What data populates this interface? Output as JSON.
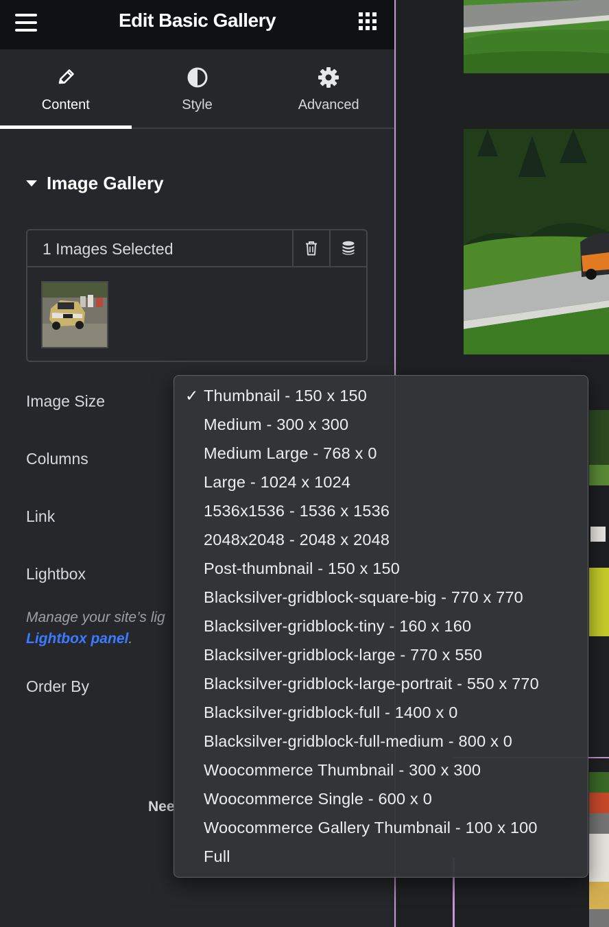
{
  "panel": {
    "title": "Edit Basic Gallery",
    "tabs": [
      {
        "label": "Content",
        "icon": "pencil-icon",
        "active": true
      },
      {
        "label": "Style",
        "icon": "half-circle-icon",
        "active": false
      },
      {
        "label": "Advanced",
        "icon": "gear-icon",
        "active": false
      }
    ],
    "section_title": "Image Gallery",
    "gallery": {
      "selected_text": "1 Images Selected",
      "thumbnail": "rally-car-thumbnail"
    },
    "fields": {
      "image_size": "Image Size",
      "columns": "Columns",
      "link": "Link",
      "lightbox": "Lightbox",
      "order_by": "Order By"
    },
    "lightbox_note": {
      "text": "Manage your site’s lig",
      "link": "Lightbox panel",
      "after": "."
    },
    "need_help": "Nee"
  },
  "dropdown": {
    "selected_index": 0,
    "check_mark": "✓",
    "options": [
      "Thumbnail - 150 x 150",
      "Medium - 300 x 300",
      "Medium Large - 768 x 0",
      "Large - 1024 x 1024",
      "1536x1536 - 1536 x 1536",
      "2048x2048 - 2048 x 2048",
      "Post-thumbnail - 150 x 150",
      "Blacksilver-gridblock-square-big - 770 x 770",
      "Blacksilver-gridblock-tiny - 160 x 160",
      "Blacksilver-gridblock-large - 770 x 550",
      "Blacksilver-gridblock-large-portrait - 550 x 770",
      "Blacksilver-gridblock-full - 1400 x 0",
      "Blacksilver-gridblock-full-medium - 800 x 0",
      "Woocommerce Thumbnail - 300 x 300",
      "Woocommerce Single - 600 x 0",
      "Woocommerce Gallery Thumbnail - 100 x 100",
      "Full"
    ]
  },
  "colors": {
    "panel_bg": "#26272a",
    "topbar_bg": "#101113",
    "accent_link": "#3b7bff",
    "guide_line": "#c696d6"
  }
}
